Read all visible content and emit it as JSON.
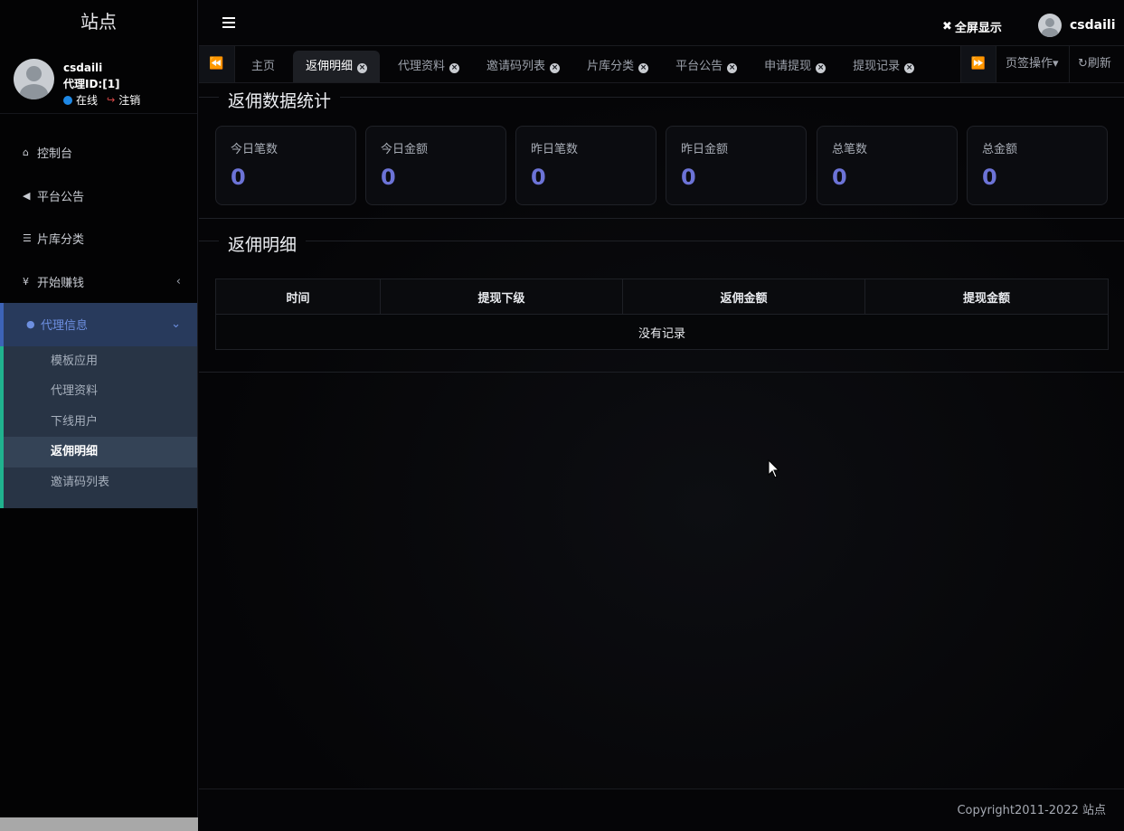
{
  "sidebar": {
    "brand": "站点",
    "user": {
      "name": "csdaili",
      "agent_id": "代理ID:[1]",
      "status": "在线",
      "logout": "注销"
    },
    "items": [
      {
        "label": "控制台",
        "icon": "home-icon"
      },
      {
        "label": "平台公告",
        "icon": "bullhorn-icon"
      },
      {
        "label": "片库分类",
        "icon": "list-icon"
      },
      {
        "label": "开始赚钱",
        "icon": "yen-icon"
      },
      {
        "label": "代理信息",
        "icon": "user-icon"
      }
    ],
    "submenu": [
      {
        "label": "模板应用"
      },
      {
        "label": "代理资料"
      },
      {
        "label": "下线用户"
      },
      {
        "label": "返佣明细"
      },
      {
        "label": "邀请码列表"
      }
    ]
  },
  "header": {
    "fullscreen": "全屏显示",
    "username": "csdaili"
  },
  "tabs": {
    "items": [
      {
        "label": "主页"
      },
      {
        "label": "返佣明细"
      },
      {
        "label": "代理资料"
      },
      {
        "label": "邀请码列表"
      },
      {
        "label": "片库分类"
      },
      {
        "label": "平台公告"
      },
      {
        "label": "申请提现"
      },
      {
        "label": "提现记录"
      }
    ],
    "ops": "页签操作",
    "refresh": "刷新"
  },
  "stats": {
    "title": "返佣数据统计",
    "cards": [
      {
        "label": "今日笔数",
        "value": "0"
      },
      {
        "label": "今日金额",
        "value": "0"
      },
      {
        "label": "昨日笔数",
        "value": "0"
      },
      {
        "label": "昨日金额",
        "value": "0"
      },
      {
        "label": "总笔数",
        "value": "0"
      },
      {
        "label": "总金额",
        "value": "0"
      }
    ]
  },
  "detail": {
    "title": "返佣明细",
    "columns": [
      "时间",
      "提现下级",
      "返佣金额",
      "提现金额"
    ],
    "empty": "没有记录"
  },
  "footer": {
    "copyright": "Copyright2011-2022 站点"
  },
  "colors": {
    "accent": "#6c73d6",
    "active_menu": "#283a5c",
    "submenu_bg": "#283445",
    "submenu_border": "#20b28e"
  }
}
